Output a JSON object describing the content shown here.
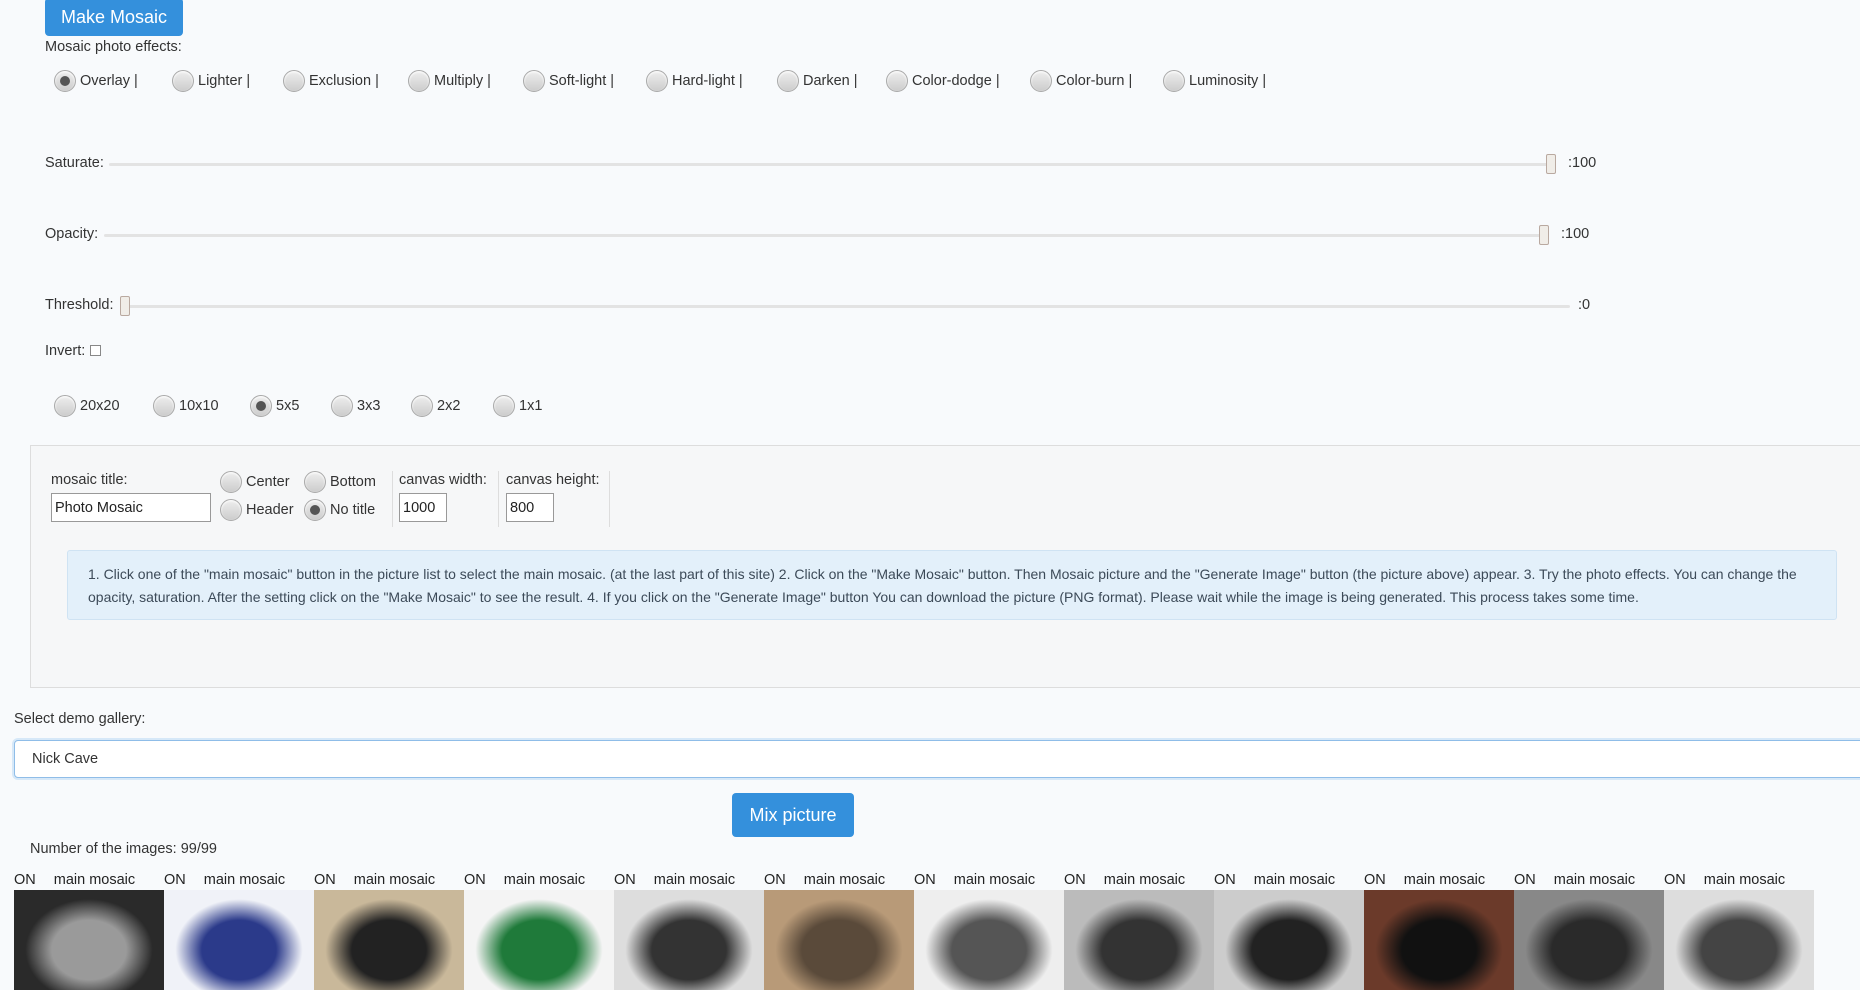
{
  "make_mosaic_label": "Make Mosaic",
  "effects": {
    "label": "Mosaic photo effects:",
    "options": [
      "Overlay |",
      "Lighter |",
      "Exclusion |",
      "Multiply |",
      "Soft-light |",
      "Hard-light |",
      "Darken |",
      "Color-dodge |",
      "Color-burn |",
      "Luminosity |"
    ],
    "selected": "Overlay |"
  },
  "sliders": {
    "saturate": {
      "label": "Saturate:",
      "value": ":100",
      "percent": 100
    },
    "opacity": {
      "label": "Opacity:",
      "value": ":100",
      "percent": 100
    },
    "threshold": {
      "label": "Threshold:",
      "value": ":0",
      "percent": 0
    }
  },
  "invert_label": "Invert:",
  "grid": {
    "options": [
      "20x20",
      "10x10",
      "5x5",
      "3x3",
      "2x2",
      "1x1"
    ],
    "selected": "5x5"
  },
  "panel": {
    "title_label": "mosaic title:",
    "title_value": "Photo Mosaic",
    "positions": [
      "Center",
      "Bottom",
      "Header",
      "No title"
    ],
    "selected_position": "No title",
    "width_label": "canvas width:",
    "width_value": "1000",
    "height_label": "canvas height:",
    "height_value": "800",
    "info": "1. Click one of the \"main mosaic\" button in the picture list to select the main mosaic. (at the last part of this site) 2. Click on the \"Make Mosaic\" button. Then Mosaic picture and the \"Generate Image\" button (the picture above) appear. 3. Try the photo effects. You can change the opacity, saturation. After the setting click on the \"Make Mosaic\" to see the result. 4. If you click on the \"Generate Image\" button You can download the picture (PNG format). Please wait while the image is being generated. This process takes some time."
  },
  "gallery": {
    "label": "Select demo gallery:",
    "selected": "Nick Cave",
    "mix_label": "Mix picture",
    "count": "Number of the images: 99/99",
    "on_label": "ON",
    "main_label": "main mosaic",
    "image_count_visible": 12
  },
  "colors": {
    "accent": "#3490dc",
    "info_bg": "#e3f0fa"
  }
}
